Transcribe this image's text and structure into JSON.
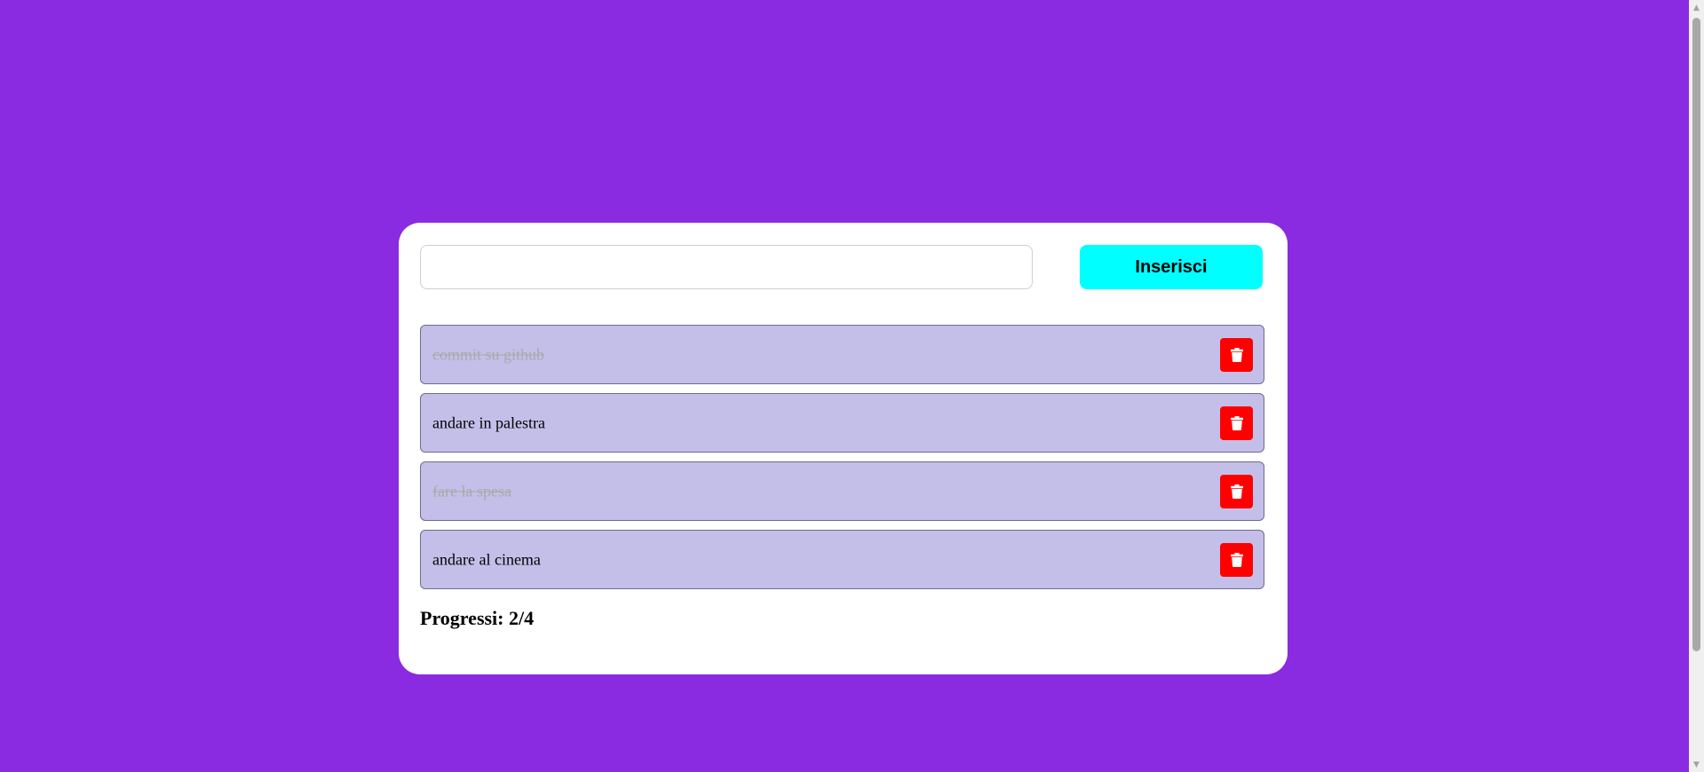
{
  "app": {
    "background_color": "#8a2be2",
    "accent_color": "#00ffff",
    "delete_color": "#ff0000"
  },
  "input": {
    "value": "",
    "placeholder": ""
  },
  "add_button": {
    "label": "Inserisci"
  },
  "todos": [
    {
      "text": "commit su github",
      "done": true,
      "delete_icon": "trash-icon"
    },
    {
      "text": "andare in palestra",
      "done": false,
      "delete_icon": "trash-icon"
    },
    {
      "text": "fare la spesa",
      "done": true,
      "delete_icon": "trash-icon"
    },
    {
      "text": "andare al cinema",
      "done": false,
      "delete_icon": "trash-icon"
    }
  ],
  "progress": {
    "label": "Progressi: 2/4"
  },
  "scrollbar": {
    "up_icon": "scroll-up-arrow-icon",
    "down_icon": "scroll-down-arrow-icon"
  }
}
